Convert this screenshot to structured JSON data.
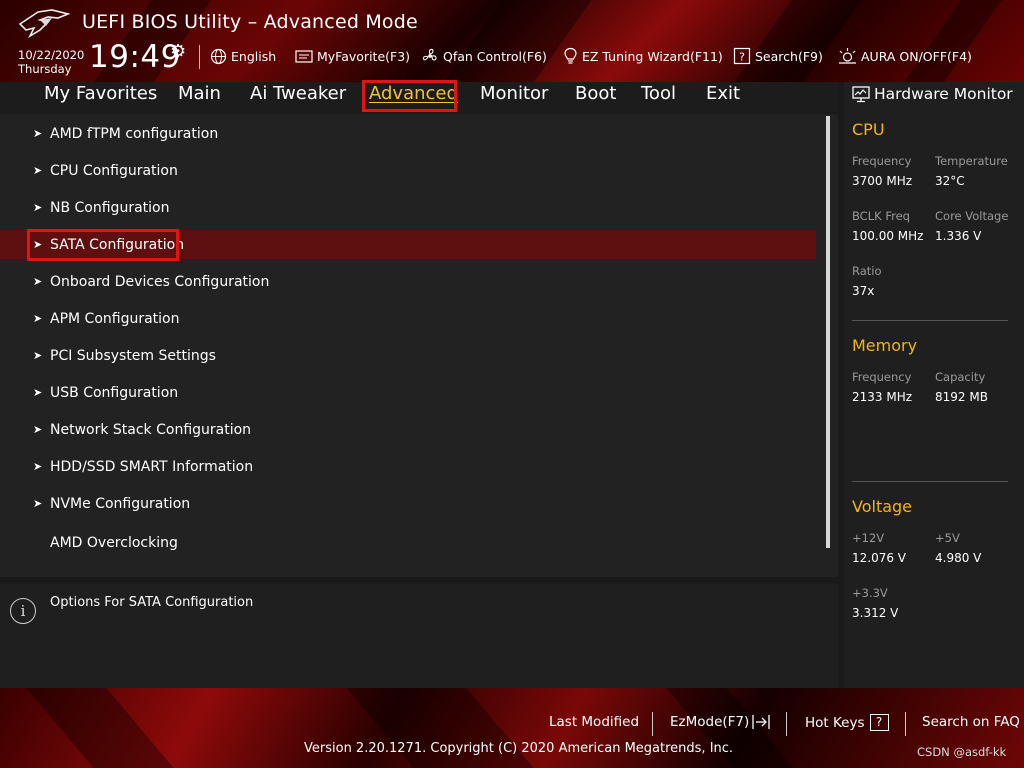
{
  "window": {
    "title": "UEFI BIOS Utility – Advanced Mode"
  },
  "clock": {
    "date": "10/22/2020",
    "day": "Thursday",
    "time": "19:49"
  },
  "toolbar": {
    "language": "English",
    "myfavorite": "MyFavorite(F3)",
    "qfan": "Qfan Control(F6)",
    "ez_tuning": "EZ Tuning Wizard(F11)",
    "search": "Search(F9)",
    "aura": "AURA ON/OFF(F4)"
  },
  "tabs": [
    {
      "label": "My Favorites"
    },
    {
      "label": "Main"
    },
    {
      "label": "Ai Tweaker"
    },
    {
      "label": "Advanced",
      "active": true
    },
    {
      "label": "Monitor"
    },
    {
      "label": "Boot"
    },
    {
      "label": "Tool"
    },
    {
      "label": "Exit"
    }
  ],
  "menu": {
    "items": [
      {
        "label": "AMD fTPM configuration",
        "submenu": true
      },
      {
        "label": "CPU Configuration",
        "submenu": true
      },
      {
        "label": "NB Configuration",
        "submenu": true
      },
      {
        "label": "SATA Configuration",
        "submenu": true,
        "selected": true
      },
      {
        "label": "Onboard Devices Configuration",
        "submenu": true
      },
      {
        "label": "APM Configuration",
        "submenu": true
      },
      {
        "label": "PCI Subsystem Settings",
        "submenu": true
      },
      {
        "label": "USB Configuration",
        "submenu": true
      },
      {
        "label": "Network Stack Configuration",
        "submenu": true
      },
      {
        "label": "HDD/SSD SMART Information",
        "submenu": true
      },
      {
        "label": "NVMe Configuration",
        "submenu": true
      },
      {
        "label": "AMD Overclocking",
        "submenu": false
      }
    ]
  },
  "help": {
    "text": "Options For SATA Configuration"
  },
  "hardware_monitor": {
    "title": "Hardware Monitor",
    "cpu": {
      "heading": "CPU",
      "frequency_label": "Frequency",
      "frequency": "3700 MHz",
      "temperature_label": "Temperature",
      "temperature": "32°C",
      "bclk_label": "BCLK Freq",
      "bclk": "100.00 MHz",
      "core_voltage_label": "Core Voltage",
      "core_voltage": "1.336 V",
      "ratio_label": "Ratio",
      "ratio": "37x"
    },
    "memory": {
      "heading": "Memory",
      "frequency_label": "Frequency",
      "frequency": "2133 MHz",
      "capacity_label": "Capacity",
      "capacity": "8192 MB"
    },
    "voltage": {
      "heading": "Voltage",
      "v12_label": "+12V",
      "v12": "12.076 V",
      "v5_label": "+5V",
      "v5": "4.980 V",
      "v33_label": "+3.3V",
      "v33": "3.312 V"
    }
  },
  "footer": {
    "last_modified": "Last Modified",
    "ezmode": "EzMode(F7)",
    "hotkeys": "Hot Keys",
    "hotkeys_key": "?",
    "faq": "Search on FAQ",
    "copyright": "Version 2.20.1271. Copyright (C) 2020 American Megatrends, Inc.",
    "watermark": "CSDN @asdf-kk"
  },
  "colors": {
    "accent_yellow": "#f2b418",
    "selected_row": "#5e1010",
    "highlight_box": "#e01515",
    "brand_red": "#8e0a0a"
  },
  "icons": [
    "rog-logo-icon",
    "gear-icon",
    "globe-icon",
    "favorite-icon",
    "fan-icon",
    "bulb-icon",
    "search-help-icon",
    "aura-icon",
    "monitor-icon",
    "info-icon",
    "exit-arrow-icon"
  ]
}
